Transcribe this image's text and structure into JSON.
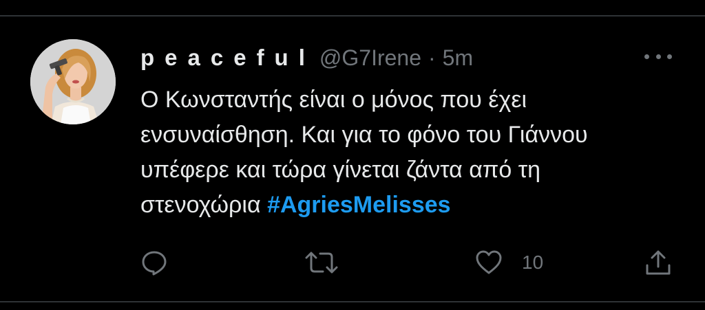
{
  "tweet": {
    "author": {
      "display_name": "peaceful",
      "handle": "@G7Irene",
      "avatar_icon": "profile-photo"
    },
    "separator": "·",
    "timestamp": "5m",
    "text_lines": [
      "Ο Κωνσταντής είναι ο μόνος που έχει",
      "ενσυναίσθηση. Και για το φόνο του Γιάννου",
      "υπέφερε και τώρα γίνεται ζάντα από τη"
    ],
    "last_line_text": "στενοχώρια",
    "hashtag": "#AgriesMelisses",
    "actions": {
      "reply_icon": "reply-icon",
      "retweet_icon": "retweet-icon",
      "like_icon": "like-icon",
      "like_count": "10",
      "share_icon": "share-icon"
    },
    "more_icon": "more-options-icon"
  },
  "colors": {
    "background": "#000000",
    "text": "#e7e9ea",
    "secondary": "#71767b",
    "link": "#1d9bf0",
    "divider": "#2f3336"
  }
}
